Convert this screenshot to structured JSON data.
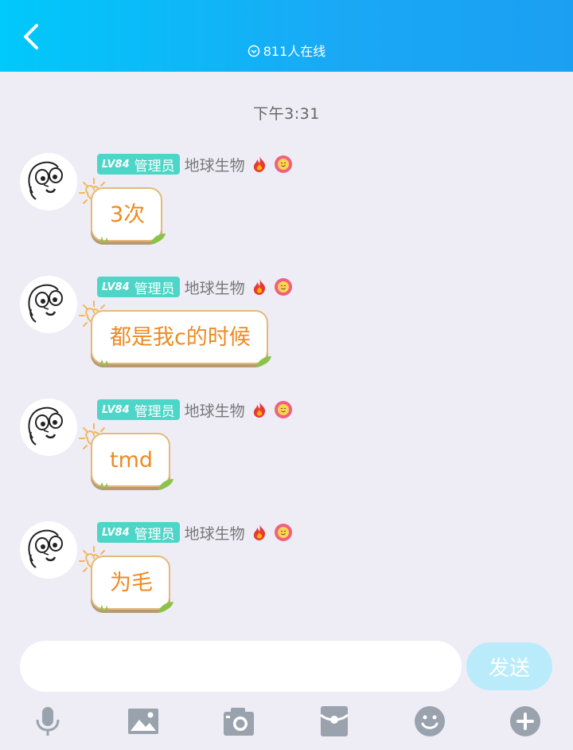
{
  "header": {
    "online_text": "811人在线"
  },
  "time_divider": "下午3:31",
  "messages": [
    {
      "level": "LV84",
      "role": "管理员",
      "name": "地球生物",
      "text": "3次"
    },
    {
      "level": "LV84",
      "role": "管理员",
      "name": "地球生物",
      "text": "都是我c的时候"
    },
    {
      "level": "LV84",
      "role": "管理员",
      "name": "地球生物",
      "text": "tmd"
    },
    {
      "level": "LV84",
      "role": "管理员",
      "name": "地球生物",
      "text": "为毛"
    }
  ],
  "input": {
    "value": "",
    "send_label": "发送"
  },
  "toolbar": [
    "microphone-icon",
    "image-icon",
    "camera-icon",
    "red-packet-icon",
    "emoji-icon",
    "plus-icon"
  ],
  "colors": {
    "header_start": "#00c9fb",
    "header_end": "#1b9ff2",
    "badge": "#4dd6c7",
    "bubble_text": "#ee8a22",
    "send_bg": "#b9ebfb"
  }
}
